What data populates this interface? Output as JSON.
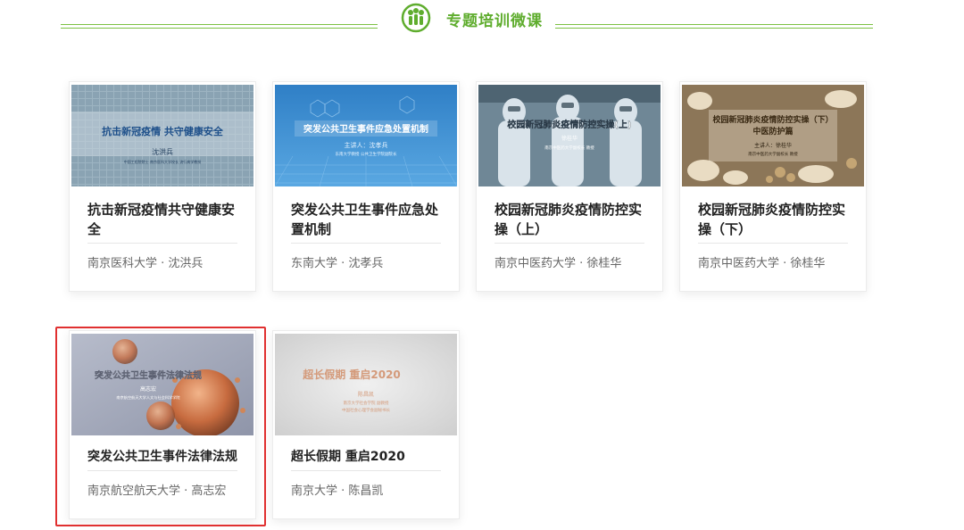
{
  "header": {
    "title": "专题培训微课"
  },
  "courses": [
    {
      "title": "抗击新冠疫情共守健康安全",
      "meta": "南京医科大学 · 沈洪兵",
      "thumb": {
        "title": "抗击新冠疫情  共守健康安全",
        "speaker": "沈洪兵",
        "sub": "中国工程院院士 南京医科大学校长 流行病学教授",
        "bg": "#8aa7b8"
      }
    },
    {
      "title": "突发公共卫生事件应急处置机制",
      "meta": "东南大学 · 沈孝兵",
      "thumb": {
        "title": "突发公共卫生事件应急处置机制",
        "speaker": "主讲人：沈孝兵",
        "sub": "东南大学教授 公共卫生学院副院长",
        "bg": "#3f8fd0"
      }
    },
    {
      "title": "校园新冠肺炎疫情防控实操（上）",
      "meta": "南京中医药大学 · 徐桂华",
      "thumb": {
        "title": "校园新冠肺炎疫情防控实操(上)",
        "speaker": "徐桂华",
        "sub": "南京中医药大学副校长 教授",
        "bg": "#7f97a6"
      }
    },
    {
      "title": "校园新冠肺炎疫情防控实操（下）",
      "meta": "南京中医药大学 · 徐桂华",
      "thumb": {
        "title": "校园新冠肺炎疫情防控实操（下）",
        "subtitle": "中医防护篇",
        "speaker": "主讲人：徐桂华",
        "sub": "南京中医药大学副校长 教授",
        "bg": "#a08a6e"
      }
    },
    {
      "title": "突发公共卫生事件法律法规",
      "meta": "南京航空航天大学 · 高志宏",
      "thumb": {
        "title": "突发公共卫生事件法律法规",
        "speaker": "高志宏",
        "sub": "南京航空航天大学人文与社会科学学院",
        "bg": "#9aa0b4"
      }
    },
    {
      "title": "超长假期 重启2020",
      "meta": "南京大学 · 陈昌凯",
      "thumb": {
        "title": "超长假期  重启2020",
        "speaker": "陈昌凯",
        "sub": "南京大学社会学院 副教授",
        "sub2": "中国社会心理学会副秘书长",
        "bg": "#dcdcdc"
      }
    }
  ],
  "colors": {
    "accent_green": "#5fad2e",
    "highlight_red": "#e03030"
  }
}
